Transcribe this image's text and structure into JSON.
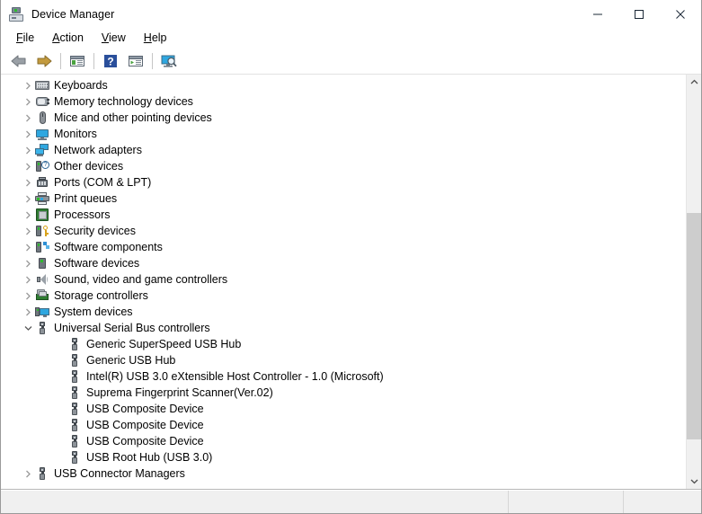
{
  "window": {
    "title": "Device Manager",
    "icon": "device-manager-icon"
  },
  "window_controls": {
    "minimize": "minimize-icon",
    "maximize": "maximize-icon",
    "close": "close-icon"
  },
  "menubar": {
    "items": [
      {
        "label": "File",
        "accesskey": "F",
        "rest": "ile"
      },
      {
        "label": "Action",
        "accesskey": "A",
        "rest": "ction"
      },
      {
        "label": "View",
        "accesskey": "V",
        "rest": "iew"
      },
      {
        "label": "Help",
        "accesskey": "H",
        "rest": "elp"
      }
    ]
  },
  "toolbar": {
    "items": [
      {
        "name": "back-button",
        "icon": "back-arrow-icon"
      },
      {
        "name": "forward-button",
        "icon": "forward-arrow-icon"
      },
      {
        "name": "toolbar-separator-1",
        "icon": "separator"
      },
      {
        "name": "show-hide-console-tree-button",
        "icon": "console-tree-icon"
      },
      {
        "name": "toolbar-separator-2",
        "icon": "separator"
      },
      {
        "name": "help-button",
        "icon": "help-question-icon"
      },
      {
        "name": "properties-button",
        "icon": "properties-icon"
      },
      {
        "name": "toolbar-separator-3",
        "icon": "separator"
      },
      {
        "name": "scan-for-hardware-changes-button",
        "icon": "scan-hardware-icon"
      }
    ]
  },
  "tree": {
    "rows": [
      {
        "label": "Keyboards",
        "level": 0,
        "state": "collapsed",
        "icon": "keyboard-icon"
      },
      {
        "label": "Memory technology devices",
        "level": 0,
        "state": "collapsed",
        "icon": "memory-technology-icon"
      },
      {
        "label": "Mice and other pointing devices",
        "level": 0,
        "state": "collapsed",
        "icon": "mouse-icon"
      },
      {
        "label": "Monitors",
        "level": 0,
        "state": "collapsed",
        "icon": "monitor-icon"
      },
      {
        "label": "Network adapters",
        "level": 0,
        "state": "collapsed",
        "icon": "network-adapter-icon"
      },
      {
        "label": "Other devices",
        "level": 0,
        "state": "collapsed",
        "icon": "other-device-icon"
      },
      {
        "label": "Ports (COM & LPT)",
        "level": 0,
        "state": "collapsed",
        "icon": "port-icon"
      },
      {
        "label": "Print queues",
        "level": 0,
        "state": "collapsed",
        "icon": "printer-icon"
      },
      {
        "label": "Processors",
        "level": 0,
        "state": "collapsed",
        "icon": "processor-icon"
      },
      {
        "label": "Security devices",
        "level": 0,
        "state": "collapsed",
        "icon": "security-device-icon"
      },
      {
        "label": "Software components",
        "level": 0,
        "state": "collapsed",
        "icon": "software-component-icon"
      },
      {
        "label": "Software devices",
        "level": 0,
        "state": "collapsed",
        "icon": "software-device-icon"
      },
      {
        "label": "Sound, video and game controllers",
        "level": 0,
        "state": "collapsed",
        "icon": "speaker-icon"
      },
      {
        "label": "Storage controllers",
        "level": 0,
        "state": "collapsed",
        "icon": "storage-controller-icon"
      },
      {
        "label": "System devices",
        "level": 0,
        "state": "collapsed",
        "icon": "system-device-icon"
      },
      {
        "label": "Universal Serial Bus controllers",
        "level": 0,
        "state": "expanded",
        "icon": "usb-icon"
      },
      {
        "label": "Generic SuperSpeed USB Hub",
        "level": 1,
        "state": "leaf",
        "icon": "usb-icon"
      },
      {
        "label": "Generic USB Hub",
        "level": 1,
        "state": "leaf",
        "icon": "usb-icon"
      },
      {
        "label": "Intel(R) USB 3.0 eXtensible Host Controller - 1.0 (Microsoft)",
        "level": 1,
        "state": "leaf",
        "icon": "usb-icon"
      },
      {
        "label": "Suprema Fingerprint Scanner(Ver.02)",
        "level": 1,
        "state": "leaf",
        "icon": "usb-icon"
      },
      {
        "label": "USB Composite Device",
        "level": 1,
        "state": "leaf",
        "icon": "usb-icon"
      },
      {
        "label": "USB Composite Device",
        "level": 1,
        "state": "leaf",
        "icon": "usb-icon"
      },
      {
        "label": "USB Composite Device",
        "level": 1,
        "state": "leaf",
        "icon": "usb-icon"
      },
      {
        "label": "USB Root Hub (USB 3.0)",
        "level": 1,
        "state": "leaf",
        "icon": "usb-icon"
      },
      {
        "label": "USB Connector Managers",
        "level": 0,
        "state": "collapsed",
        "icon": "usb-icon"
      }
    ]
  },
  "scrollbar": {
    "up_arrow": "scroll-up-icon",
    "down_arrow": "scroll-down-icon",
    "thumb_top_pct": 32,
    "thumb_height_pct": 59
  },
  "statusbar": {
    "pane_1": "",
    "pane_2": "",
    "pane_3": ""
  },
  "colors": {
    "window_bg": "#ffffff",
    "toolbar_bg": "#ffffff",
    "statusbar_bg": "#f0f0f0",
    "scrollbar_track": "#f0f0f0",
    "scrollbar_thumb": "#cdcdcd",
    "text": "#000000",
    "chevron": "#9a9a9a",
    "accent_blue": "#2ea7e0",
    "accent_green": "#2fbb2f"
  }
}
